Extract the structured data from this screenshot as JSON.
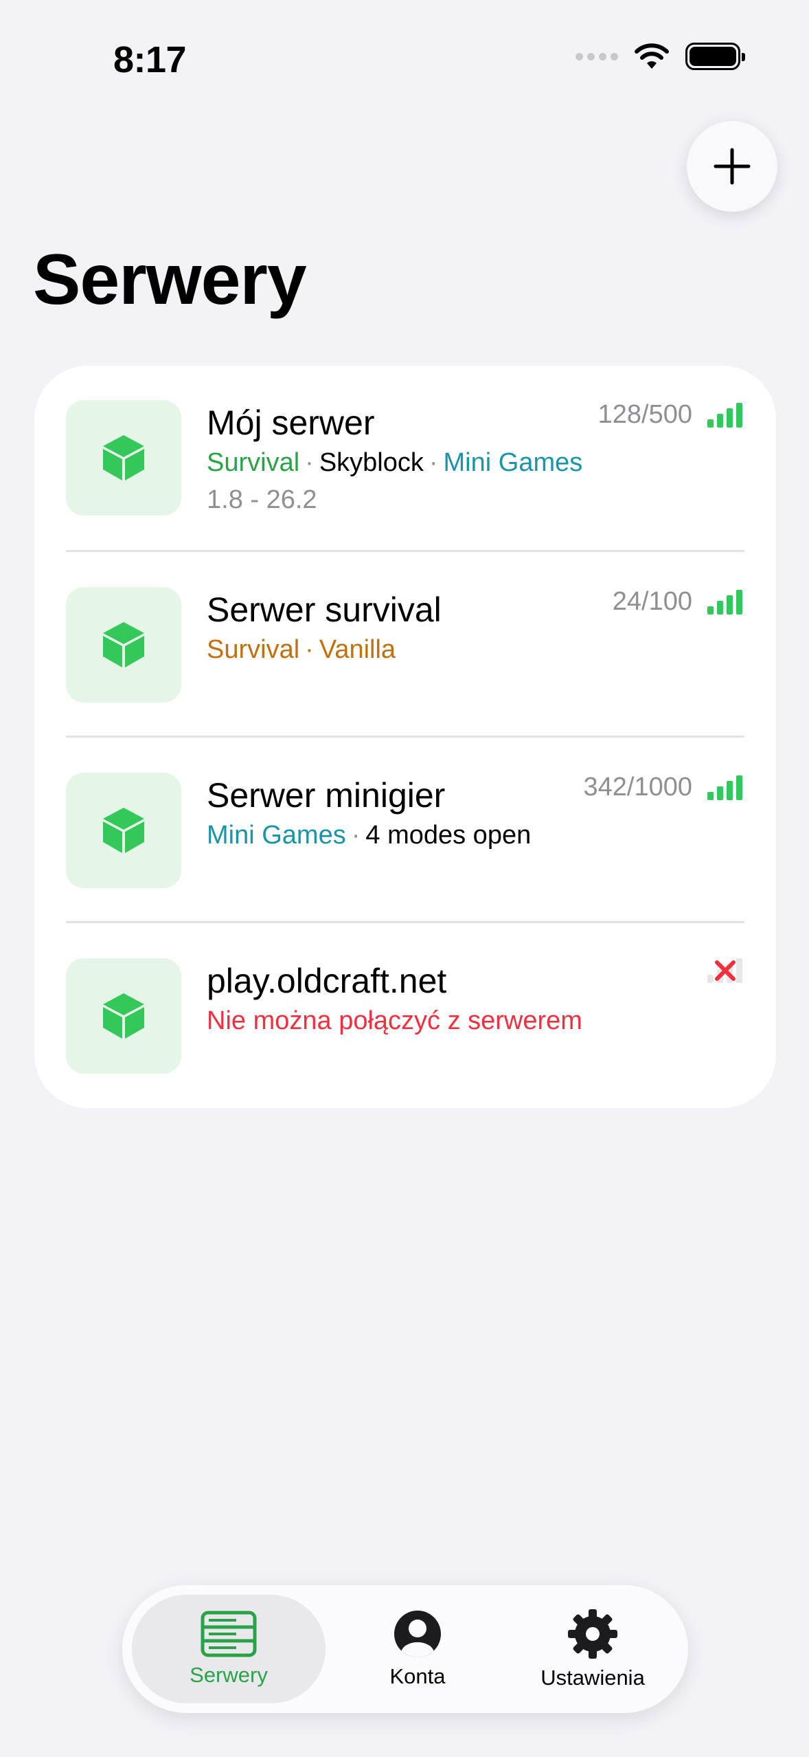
{
  "status_bar": {
    "time": "8:17"
  },
  "header": {
    "title": "Serwery"
  },
  "colors": {
    "accent_green": "#34c759",
    "survival_green": "#2aa348",
    "teal": "#1a95a8",
    "orange": "#c0700e",
    "error_red": "#f0303f",
    "muted": "#8e8e93"
  },
  "servers": [
    {
      "name": "Mój serwer",
      "players": "128/500",
      "tags": [
        {
          "text": "Survival",
          "color": "#2aa348"
        },
        {
          "text": "Skyblock",
          "color": "#000000"
        },
        {
          "text": "Mini Games",
          "color": "#1a95a8"
        }
      ],
      "version": "1.8 - 26.2",
      "status": "online"
    },
    {
      "name": "Serwer survival",
      "players": "24/100",
      "tags": [
        {
          "text": "Survival",
          "color": "#c0700e"
        },
        {
          "text": "Vanilla",
          "color": "#c0700e"
        }
      ],
      "status": "online"
    },
    {
      "name": "Serwer minigier",
      "players": "342/1000",
      "tags": [
        {
          "text": "Mini Games",
          "color": "#1a95a8"
        },
        {
          "text": "4 modes open",
          "color": "#000000"
        }
      ],
      "status": "online"
    },
    {
      "name": "play.oldcraft.net",
      "error": "Nie można połączyć z serwerem",
      "status": "offline"
    }
  ],
  "tab_bar": {
    "tabs": [
      {
        "label": "Serwery",
        "icon": "server-rack-icon",
        "active": true
      },
      {
        "label": "Konta",
        "icon": "person-circle-icon",
        "active": false
      },
      {
        "label": "Ustawienia",
        "icon": "gear-icon",
        "active": false
      }
    ]
  }
}
